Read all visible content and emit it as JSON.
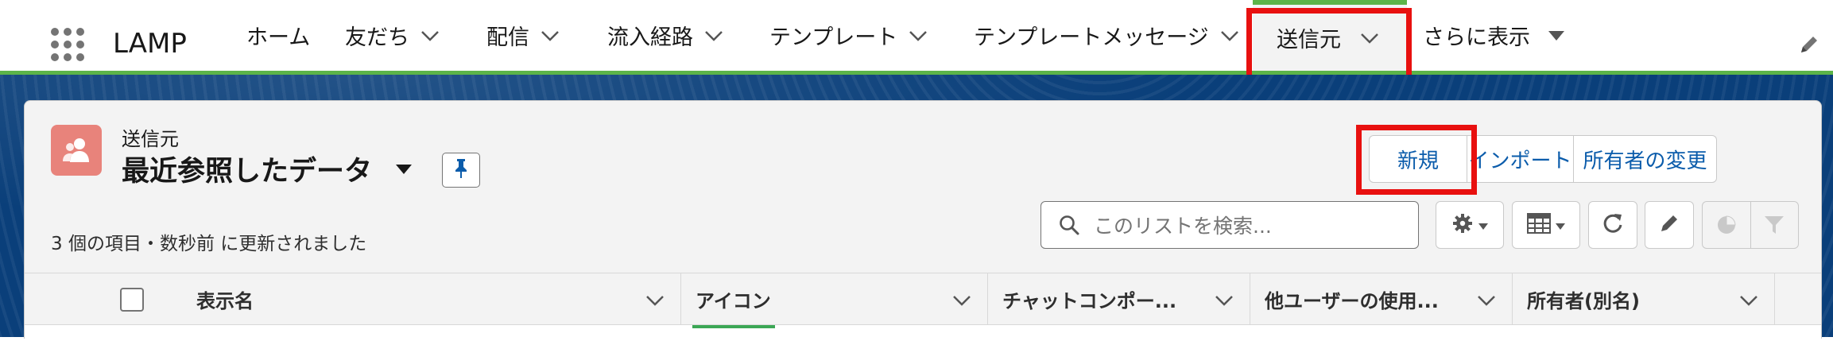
{
  "app": {
    "name": "LAMP"
  },
  "nav": {
    "items": [
      {
        "label": "ホーム",
        "has_menu": false
      },
      {
        "label": "友だち",
        "has_menu": true
      },
      {
        "label": "配信",
        "has_menu": true
      },
      {
        "label": "流入経路",
        "has_menu": true
      },
      {
        "label": "テンプレート",
        "has_menu": true
      },
      {
        "label": "テンプレートメッセージ",
        "has_menu": true
      },
      {
        "label": "送信元",
        "has_menu": true,
        "active": true
      },
      {
        "label": "さらに表示",
        "has_menu": true
      }
    ]
  },
  "list_view": {
    "object_label": "送信元",
    "title": "最近参照したデータ",
    "status": "3 個の項目・数秒前 に更新されました",
    "buttons": {
      "new": "新規",
      "import": "インポート",
      "change_owner": "所有者の変更"
    },
    "search": {
      "placeholder": "このリストを検索...",
      "value": ""
    },
    "columns": [
      {
        "label": "表示名"
      },
      {
        "label": "アイコン"
      },
      {
        "label": "チャットコンポー..."
      },
      {
        "label": "他ユーザーの使用..."
      },
      {
        "label": "所有者(別名)"
      }
    ]
  },
  "colors": {
    "accent_green": "#5cb449",
    "highlight_red": "#e8100f",
    "object_icon": "#e8837b",
    "link_blue": "#0b5cab"
  },
  "icons": {
    "app_launcher": "waffle-icon",
    "object": "contact-icon",
    "pin": "pin-icon",
    "search": "search-icon",
    "settings": "gear-icon",
    "display": "table-icon",
    "refresh": "refresh-icon",
    "edit": "pencil-icon",
    "chart": "pie-chart-icon",
    "filter": "filter-icon"
  }
}
